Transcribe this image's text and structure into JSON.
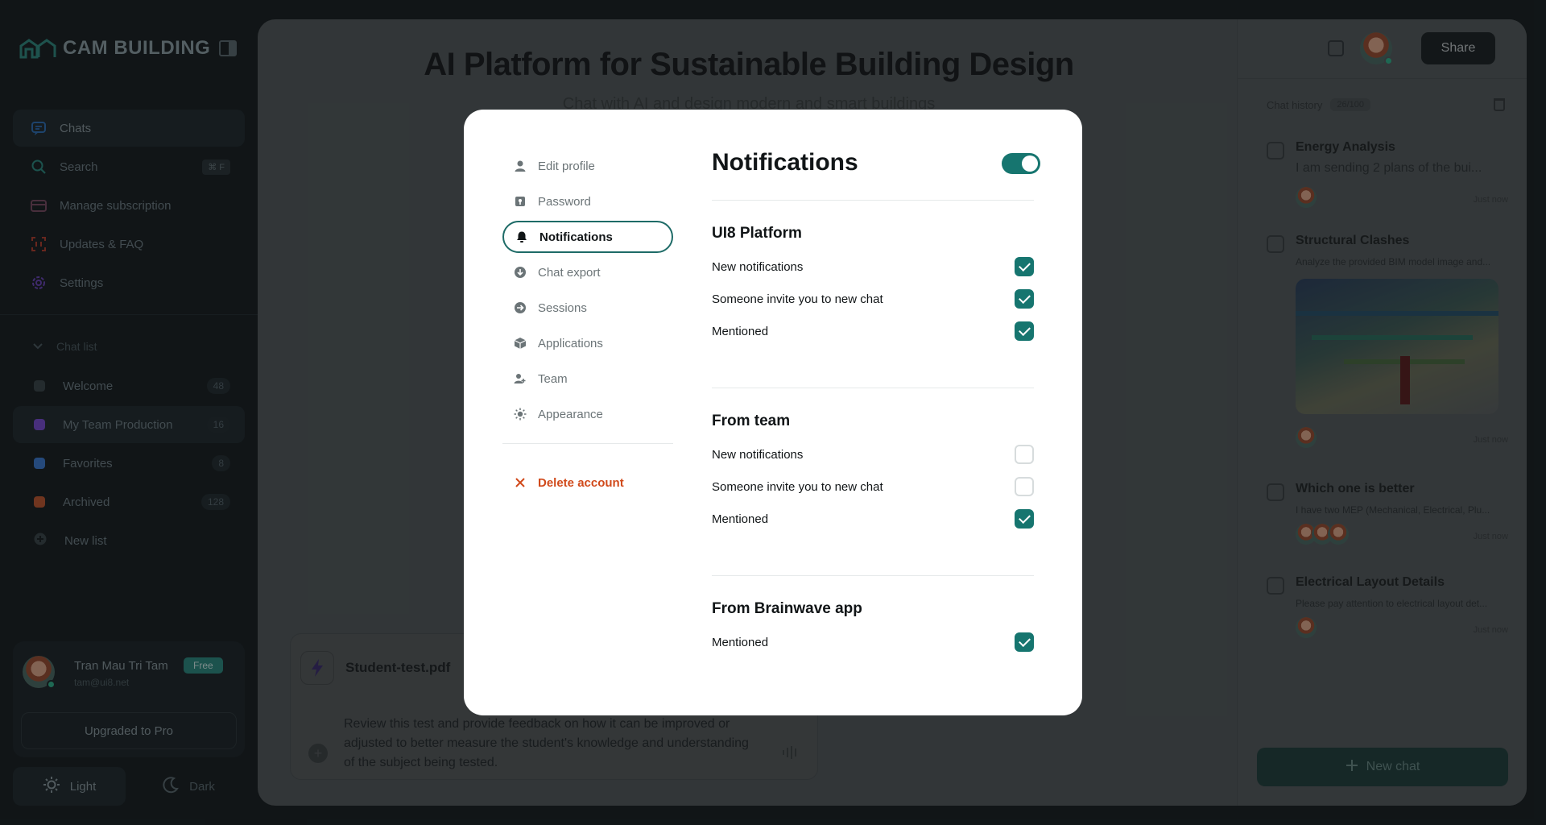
{
  "app": {
    "brand": "CAM BUILDING",
    "nav": [
      {
        "label": "Chats",
        "icon": "chat-icon"
      },
      {
        "label": "Search",
        "icon": "search-icon",
        "shortcut": "⌘ F"
      },
      {
        "label": "Manage subscription",
        "icon": "card-icon"
      },
      {
        "label": "Updates & FAQ",
        "icon": "scan-icon"
      },
      {
        "label": "Settings",
        "icon": "gear-icon"
      }
    ],
    "chat_list_heading": "Chat list",
    "lists": [
      {
        "label": "Welcome",
        "count": "48",
        "color": "#3a4447"
      },
      {
        "label": "My Team Production",
        "count": "16",
        "color": "#7a4bd6"
      },
      {
        "label": "Favorites",
        "count": "8",
        "color": "#3b7bd4"
      },
      {
        "label": "Archived",
        "count": "128",
        "color": "#c3562c"
      },
      {
        "label": "New list",
        "count": "",
        "color": ""
      }
    ],
    "user": {
      "name": "Tran Mau Tri Tam",
      "email": "tam@ui8.net",
      "plan": "Free"
    },
    "upgrade_label": "Upgraded to Pro",
    "theme": {
      "light": "Light",
      "dark": "Dark"
    }
  },
  "main": {
    "title": "AI Platform for Sustainable Building Design",
    "subtitle": "Chat with AI and design modern and smart buildings",
    "composer": {
      "file_name": "Student-test.pdf",
      "text": "Review this test and provide feedback on how it can be improved or adjusted to better measure the student's knowledge and understanding of the subject being tested."
    }
  },
  "right_panel": {
    "share_label": "Share",
    "history_label": "Chat history",
    "history_count": "26/100",
    "items": [
      {
        "title": "Energy Analysis",
        "snippet": "I am sending 2 plans of the bui...",
        "time": "Just now"
      },
      {
        "title": "Structural Clashes",
        "snippet": "Analyze the provided BIM model image and...",
        "time": "Just now"
      },
      {
        "title": "Which one is better",
        "snippet": "I have two MEP (Mechanical, Electrical, Plu...",
        "time": "Just now"
      },
      {
        "title": "Electrical Layout Details",
        "snippet": "Please pay attention to electrical layout det...",
        "time": "Just now"
      }
    ],
    "new_chat_label": "New chat"
  },
  "modal": {
    "menu": [
      {
        "label": "Edit profile",
        "icon": "user-icon"
      },
      {
        "label": "Password",
        "icon": "key-icon"
      },
      {
        "label": "Notifications",
        "icon": "bell-icon",
        "active": true
      },
      {
        "label": "Chat export",
        "icon": "download-icon"
      },
      {
        "label": "Sessions",
        "icon": "arrow-circle-icon"
      },
      {
        "label": "Applications",
        "icon": "cube-icon"
      },
      {
        "label": "Team",
        "icon": "team-icon"
      },
      {
        "label": "Appearance",
        "icon": "sun-icon"
      }
    ],
    "delete_label": "Delete account",
    "title": "Notifications",
    "master_toggle": true,
    "sections": [
      {
        "title": "UI8 Platform",
        "rows": [
          {
            "label": "New notifications",
            "checked": true
          },
          {
            "label": "Someone invite you to new chat",
            "checked": true
          },
          {
            "label": "Mentioned",
            "checked": true
          }
        ]
      },
      {
        "title": "From team",
        "rows": [
          {
            "label": "New notifications",
            "checked": false
          },
          {
            "label": "Someone invite you to new chat",
            "checked": false
          },
          {
            "label": "Mentioned",
            "checked": true
          }
        ]
      },
      {
        "title": "From Brainwave app",
        "rows": [
          {
            "label": "Mentioned",
            "checked": true
          }
        ]
      }
    ]
  }
}
